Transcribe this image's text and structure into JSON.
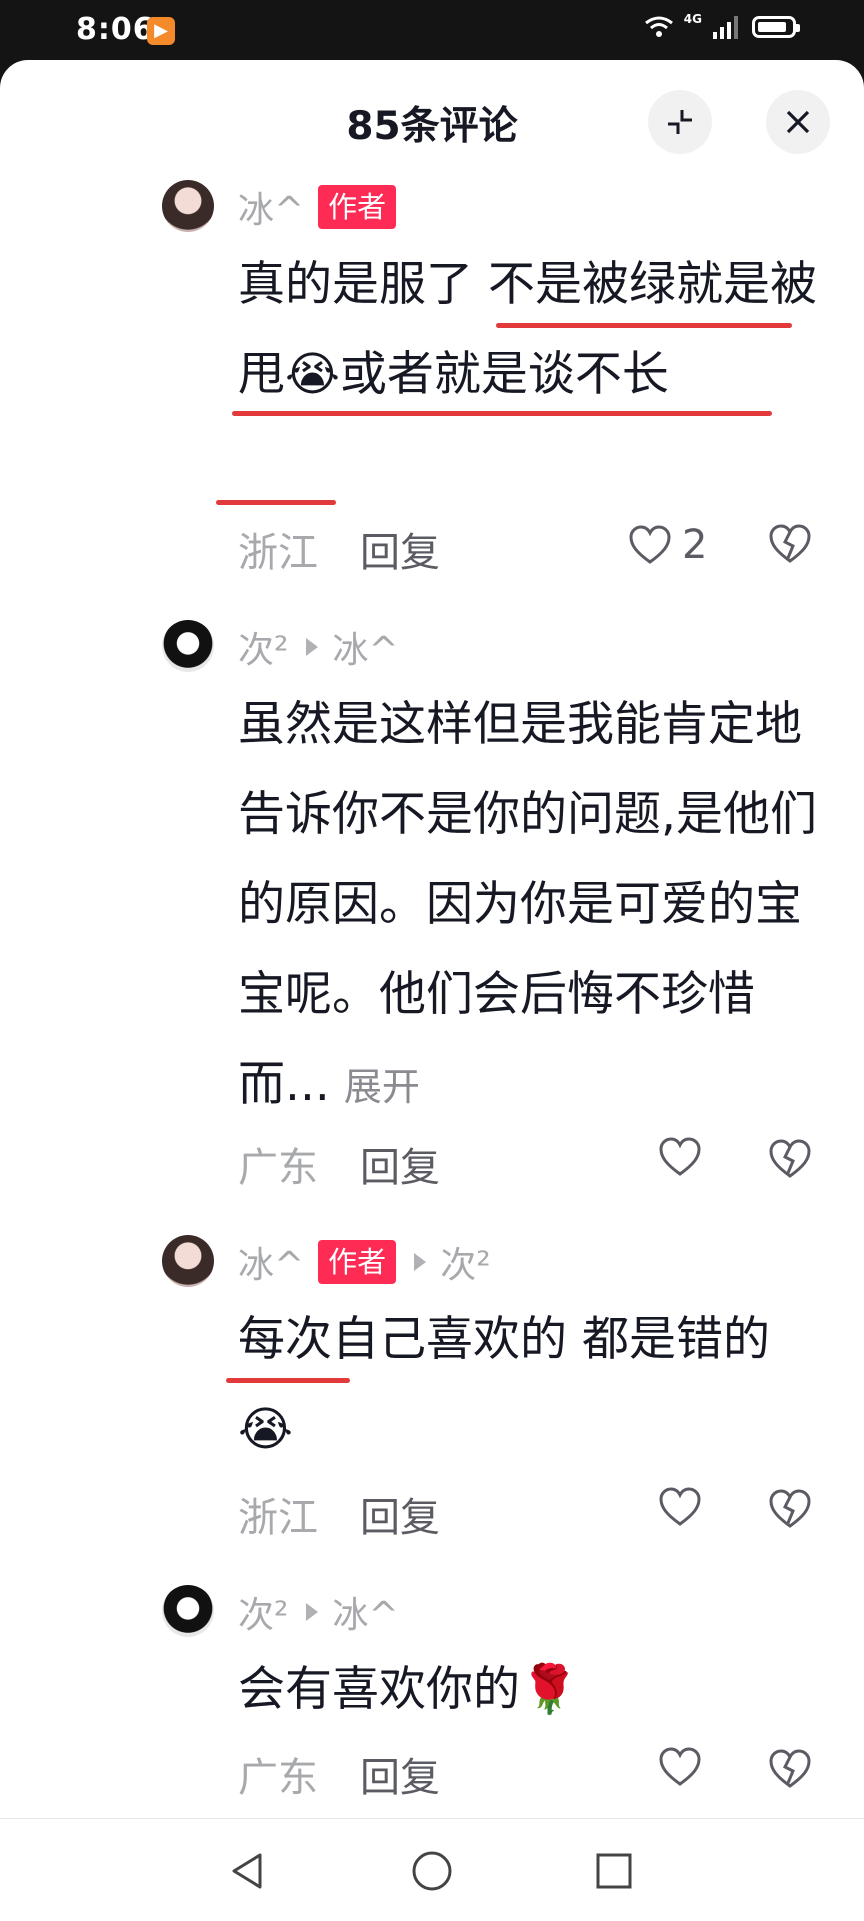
{
  "status": {
    "time": "8:06",
    "app_icon": "play-badge-icon",
    "network": "4G"
  },
  "sheet": {
    "title": "85条评论",
    "collapse_icon": "collapse-icon",
    "close_icon": "close-icon"
  },
  "comments": [
    {
      "user": "冰^",
      "author_badge": "作者",
      "text": "真的是服了 不是被绿就是被甩😭或者就是谈不长",
      "location": "浙江",
      "reply": "回复",
      "likes": "2"
    },
    {
      "user": "次²",
      "reply_to": "冰^",
      "text": "虽然是这样但是我能肯定地告诉你不是你的问题,是他们的原因。因为你是可爱的宝宝呢。他们会后悔不珍惜而...",
      "expand": "展开",
      "location": "广东",
      "reply": "回复"
    },
    {
      "user": "冰^",
      "author_badge": "作者",
      "reply_to": "次²",
      "text": "每次自己喜欢的 都是错的😭",
      "location": "浙江",
      "reply": "回复"
    },
    {
      "user": "次²",
      "reply_to": "冰^",
      "text": "会有喜欢你的🌹",
      "location": "广东",
      "reply": "回复"
    }
  ],
  "navbar": {
    "back_icon": "back-icon",
    "home_icon": "home-icon",
    "recents_icon": "recents-icon"
  },
  "colors": {
    "accent": "#fe2c55",
    "underline": "#e23a3a",
    "muted": "#a8a9ad"
  }
}
